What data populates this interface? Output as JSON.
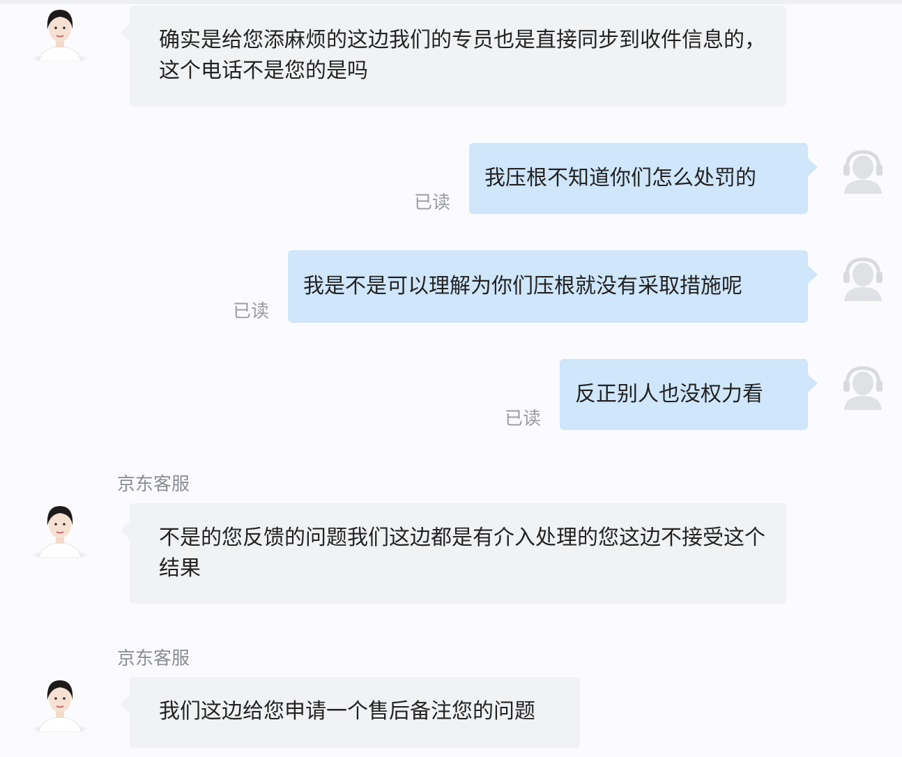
{
  "agent_name": "京东客服",
  "read_status": "已读",
  "messages": [
    {
      "sender": "agent",
      "text": "确实是给您添麻烦的这边我们的专员也是直接同步到收件信息的，这个电话不是您的是吗"
    },
    {
      "sender": "user",
      "text": "我压根不知道你们怎么处罚的"
    },
    {
      "sender": "user",
      "text": "我是不是可以理解为你们压根就没有采取措施呢"
    },
    {
      "sender": "user",
      "text": "反正别人也没权力看"
    },
    {
      "sender": "agent",
      "text": "不是的您反馈的问题我们这边都是有介入处理的您这边不接受这个结果"
    },
    {
      "sender": "agent",
      "text": "我们这边给您申请一个售后备注您的问题"
    }
  ],
  "icons": {
    "agent_avatar": "agent-avatar-icon",
    "user_avatar": "user-avatar-icon"
  },
  "colors": {
    "agent_bubble": "#f1f2f4",
    "user_bubble": "#cfe6fb",
    "background": "#fbfbfd"
  }
}
